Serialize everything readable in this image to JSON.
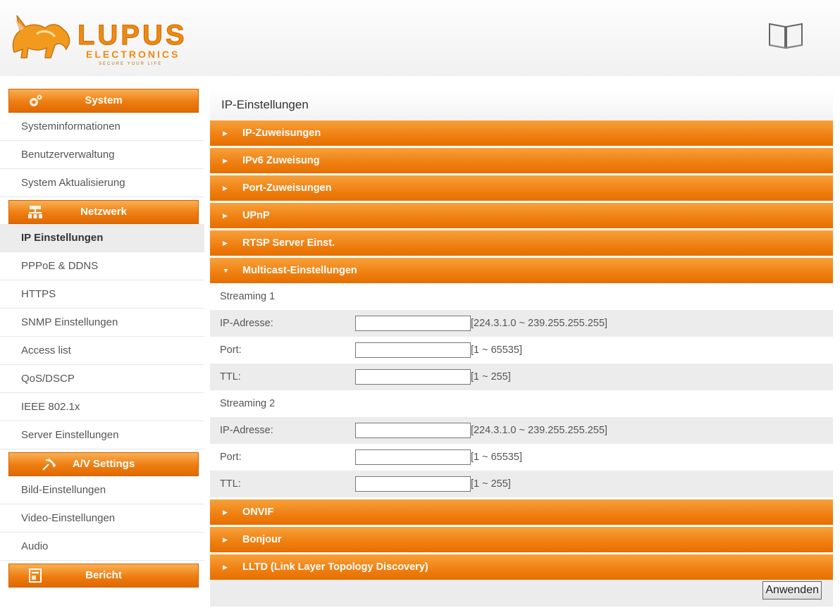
{
  "brand": {
    "name": "LUPUS",
    "sub": "ELECTRONICS",
    "tagline": "SECURE YOUR LIFE"
  },
  "sidebar": {
    "sections": [
      {
        "title": "System",
        "icon": "gear-icon",
        "items": [
          "Systeminformationen",
          "Benutzerverwaltung",
          "System Aktualisierung"
        ]
      },
      {
        "title": "Netzwerk",
        "icon": "network-icon",
        "items": [
          "IP Einstellungen",
          "PPPoE & DDNS",
          "HTTPS",
          "SNMP Einstellungen",
          "Access list",
          "QoS/DSCP",
          "IEEE 802.1x",
          "Server Einstellungen"
        ]
      },
      {
        "title": "A/V Settings",
        "icon": "satellite-icon",
        "items": [
          "Bild-Einstellungen",
          "Video-Einstellungen",
          "Audio"
        ]
      },
      {
        "title": "Bericht",
        "icon": "report-icon",
        "items": []
      }
    ],
    "active_item": "IP Einstellungen"
  },
  "main": {
    "title": "IP-Einstellungen",
    "accordions_top": [
      "IP-Zuweisungen",
      "IPv6 Zuweisung",
      "Port-Zuweisungen",
      "UPnP",
      "RTSP Server Einst."
    ],
    "open_accordion": "Multicast-Einstellungen",
    "streams": [
      {
        "heading": "Streaming 1",
        "fields": [
          {
            "label": "IP-Adresse:",
            "value": "",
            "hint": "[224.3.1.0 ~ 239.255.255.255]"
          },
          {
            "label": "Port:",
            "value": "",
            "hint": "[1 ~ 65535]"
          },
          {
            "label": "TTL:",
            "value": "",
            "hint": "[1 ~ 255]"
          }
        ]
      },
      {
        "heading": "Streaming 2",
        "fields": [
          {
            "label": "IP-Adresse:",
            "value": "",
            "hint": "[224.3.1.0 ~ 239.255.255.255]"
          },
          {
            "label": "Port:",
            "value": "",
            "hint": "[1 ~ 65535]"
          },
          {
            "label": "TTL:",
            "value": "",
            "hint": "[1 ~ 255]"
          }
        ]
      }
    ],
    "accordions_bottom": [
      "ONVIF",
      "Bonjour",
      "LLTD (Link Layer Topology Discovery)"
    ],
    "apply_label": "Anwenden"
  },
  "colors": {
    "accent": "#ef7f10",
    "accent_dark": "#d06000",
    "active_row": "#ececec"
  }
}
